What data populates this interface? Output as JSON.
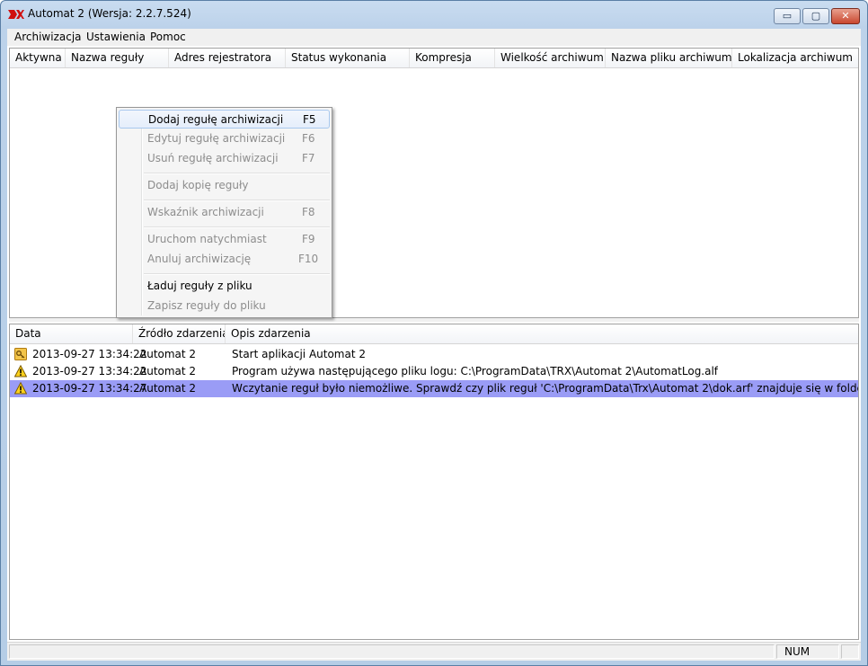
{
  "window": {
    "title": "Automat 2 (Wersja: 2.2.7.524)"
  },
  "controls": {
    "minimize_glyph": "▭",
    "maximize_glyph": "▢",
    "close_glyph": "✕"
  },
  "menu": [
    "Archiwizacja",
    "Ustawienia",
    "Pomoc"
  ],
  "rules_table": {
    "columns": [
      "Aktywna",
      "Nazwa reguły",
      "Adres rejestratora",
      "Status wykonania",
      "Kompresja",
      "Wielkość archiwum",
      "Nazwa pliku archiwum",
      "Lokalizacja archiwum"
    ],
    "rows": []
  },
  "context_menu": {
    "items": [
      {
        "label": "Dodaj regułę archiwizacji",
        "shortcut": "F5",
        "enabled": true,
        "highlighted": true
      },
      {
        "label": "Edytuj regułę archiwizacji",
        "shortcut": "F6",
        "enabled": false
      },
      {
        "label": "Usuń regułę archiwizacji",
        "shortcut": "F7",
        "enabled": false
      },
      {
        "label": "Dodaj kopię reguły",
        "shortcut": "",
        "enabled": false
      },
      {
        "label": "Wskaźnik archiwizacji",
        "shortcut": "F8",
        "enabled": false
      },
      {
        "label": "Uruchom natychmiast",
        "shortcut": "F9",
        "enabled": false
      },
      {
        "label": "Anuluj archiwizację",
        "shortcut": "F10",
        "enabled": false
      },
      {
        "label": "Ładuj reguły z pliku",
        "shortcut": "",
        "enabled": true
      },
      {
        "label": "Zapisz reguły do pliku",
        "shortcut": "",
        "enabled": false
      }
    ]
  },
  "log_table": {
    "columns": [
      "Data",
      "Źródło zdarzenia",
      "Opis zdarzenia"
    ],
    "rows": [
      {
        "icon": "key-icon",
        "date": "2013-09-27 13:34:22",
        "source": "Automat 2",
        "description": "Start aplikacji Automat 2"
      },
      {
        "icon": "warning-icon",
        "date": "2013-09-27 13:34:22",
        "source": "Automat 2",
        "description": "Program używa następującego pliku logu: C:\\ProgramData\\TRX\\Automat 2\\AutomatLog.alf"
      },
      {
        "icon": "warning-icon",
        "date": "2013-09-27 13:34:27",
        "source": "Automat 2",
        "description": "Wczytanie reguł było niemożliwe. Sprawdź czy plik reguł 'C:\\ProgramData\\Trx\\Automat 2\\dok.arf' znajduje się w folderze programu l",
        "selected": true
      }
    ]
  },
  "statusbar": {
    "num": "NUM"
  },
  "colors": {
    "selection": "#9a9cf6",
    "menu_highlight_border": "#a8c8ee"
  }
}
